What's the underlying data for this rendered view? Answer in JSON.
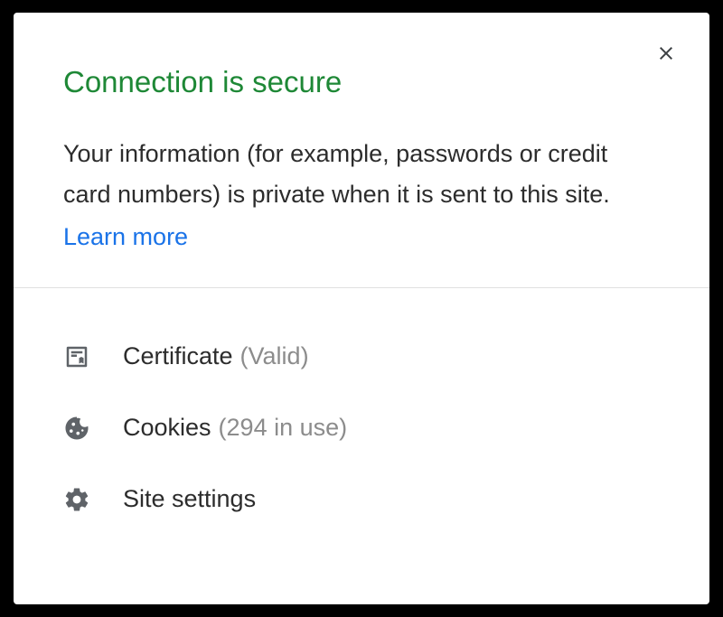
{
  "title": "Connection is secure",
  "description": "Your information (for example, passwords or credit card numbers) is private when it is sent to this site.",
  "learn_more": "Learn more",
  "items": {
    "certificate": {
      "label": "Certificate",
      "status": "(Valid)"
    },
    "cookies": {
      "label": "Cookies",
      "status": "(294 in use)"
    },
    "site_settings": {
      "label": "Site settings",
      "status": ""
    }
  }
}
